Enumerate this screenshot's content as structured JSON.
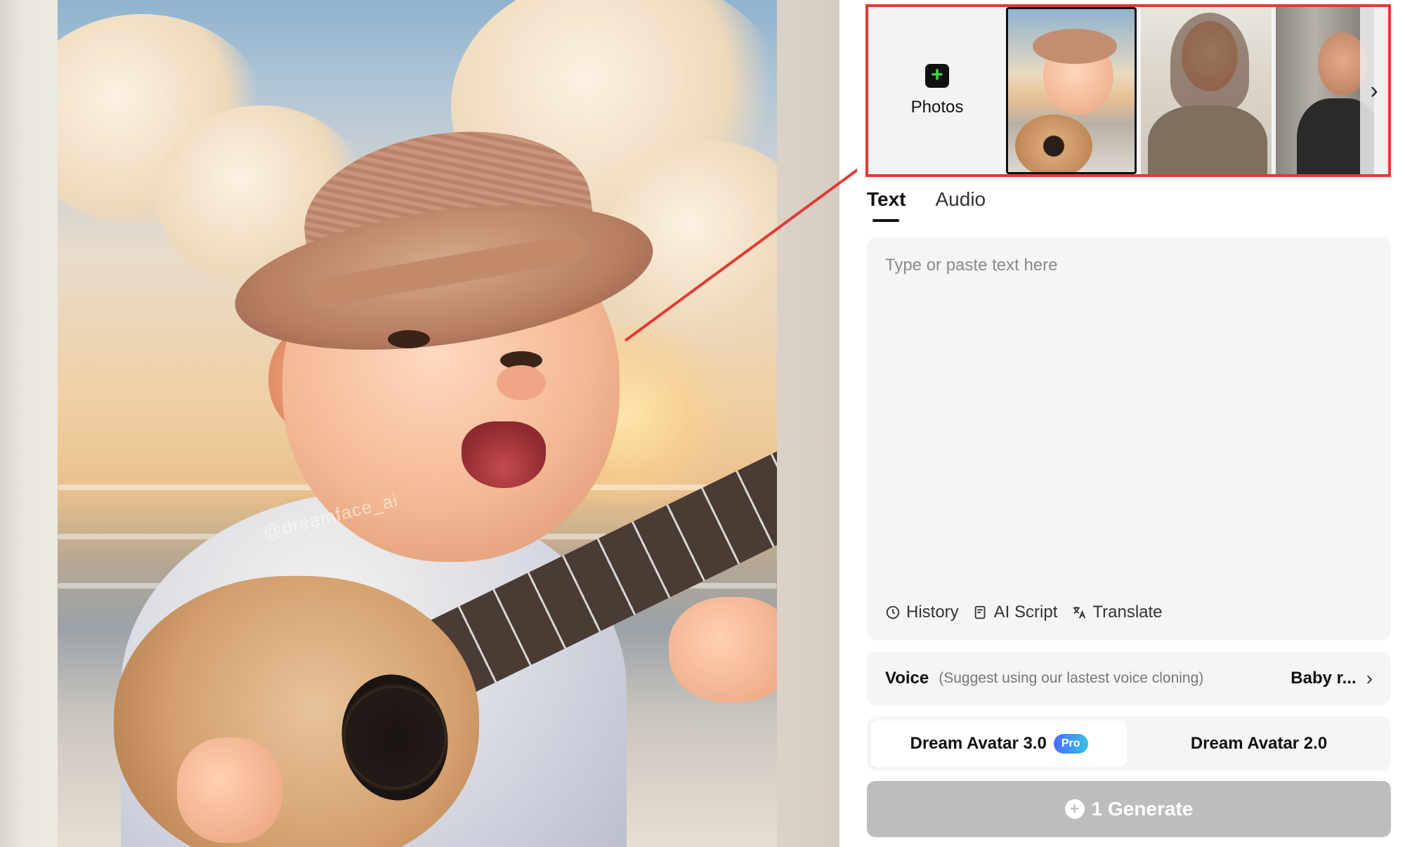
{
  "preview": {
    "watermark": "@dreamface_ai"
  },
  "photos": {
    "add_label": "Photos",
    "thumbnails": [
      "baby-with-ukulele",
      "smiling-woman",
      "man-in-jacket"
    ]
  },
  "tabs": [
    {
      "label": "Text",
      "active": true
    },
    {
      "label": "Audio",
      "active": false
    }
  ],
  "editor": {
    "placeholder": "Type or paste text here",
    "tools": [
      {
        "label": "History",
        "icon": "history-icon"
      },
      {
        "label": "AI Script",
        "icon": "ai-script-icon"
      },
      {
        "label": "Translate",
        "icon": "translate-icon"
      }
    ]
  },
  "voice": {
    "label": "Voice",
    "hint": "(Suggest using our lastest voice cloning)",
    "value": "Baby r..."
  },
  "models": [
    {
      "label": "Dream Avatar 3.0",
      "badge": "Pro",
      "active": true
    },
    {
      "label": "Dream Avatar 2.0",
      "active": false
    }
  ],
  "generate": {
    "label": "1 Generate"
  },
  "colors": {
    "highlight_border": "#e53935",
    "plus_icon": "#3ddc4a",
    "generate_disabled": "#bdbdbd"
  }
}
